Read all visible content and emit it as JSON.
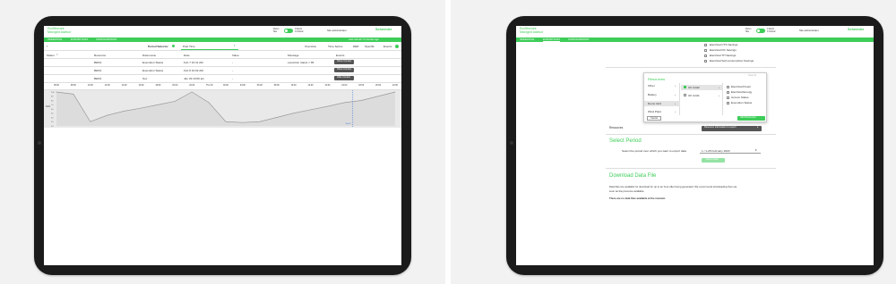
{
  "common": {
    "app_line1": "EcoStruxure",
    "app_line2": "Microgrid Advisor",
    "site_label_1": "Demo",
    "site_label_2": "Site",
    "alerts_1": "0 Alerts",
    "alerts_2": "0 Critical",
    "user": "Site administrator",
    "brand": "Schneider",
    "nav": [
      "OPERATION",
      "EXPORT DATA",
      "CONFIGURATION"
    ],
    "last_refresh": "Last refresh: 5 minutes ago"
  },
  "left": {
    "period_selector": "Period Selector",
    "period_value": "Past Time",
    "view_tabs": [
      "Overview",
      "Time Series",
      "DER",
      "Specific",
      "Events"
    ],
    "table_headers": [
      "Status",
      "Resource",
      "Data name",
      "Date",
      "Value",
      "Message",
      "Events"
    ],
    "rows": [
      {
        "resource": "BESS",
        "data_name": "Execution Status",
        "date": "Feb 7 10:11 AM",
        "value": "-",
        "message": "execution status = 86",
        "action": "Show Context"
      },
      {
        "resource": "BESS",
        "data_name": "Execution Status",
        "date": "Feb 8 10:02 AM",
        "value": "-",
        "message": "",
        "action": "Show Context"
      },
      {
        "resource": "BESS",
        "data_name": "Soc",
        "date": "Jan 29 10:06 am",
        "value": "-",
        "message": "",
        "action": "Hide Context"
      }
    ],
    "time_axis": [
      "06:00",
      "08:00",
      "10:00",
      "12:00",
      "14:00",
      "16:00",
      "18:00",
      "20:00",
      "22:00",
      "Thu 30",
      "02:00",
      "04:00",
      "06:00",
      "08:00",
      "10:00",
      "12:00",
      "14:00",
      "16:00",
      "18:00",
      "20:00",
      "22:00"
    ],
    "y_label": "SOC",
    "y_ticks": [
      "100",
      "90",
      "80",
      "70",
      "60",
      "50",
      "40",
      "30",
      "20"
    ],
    "marker_label": "Feb 8"
  },
  "right": {
    "checkbox_options": [
      "Electrical CTS Savings",
      "Electrical DC Savings",
      "Electrical TH Savings",
      "Electrical Self-consumption Savings"
    ],
    "resources_title": "Resources",
    "clear_all": "Clear all",
    "categories": [
      "Other",
      "Battery",
      "Demo Grid",
      "Wind Plant"
    ],
    "sub_items": [
      "UK Grid2",
      "UK Grid1"
    ],
    "data_items": [
      "Electrical Power",
      "Electrical Energy",
      "Access Status",
      "Execution Status"
    ],
    "cancel": "Cancel",
    "add_resources": "Add Resources",
    "resources_label": "Resources",
    "resource_info": "Resource information to export",
    "select_period": "Select Period",
    "period_prompt": "Select the period over which you want to export data",
    "period_value": "1 / 1-28 February 2020",
    "export_button": "Export Data",
    "download_title": "Download Data File",
    "download_desc_1": "Data files are available for download for up to an hour after being generated. We recommend downloading them as",
    "download_desc_2": "soon as they become available.",
    "no_files": "There are no data files available at the moment."
  },
  "chart_data": {
    "type": "line",
    "title": "",
    "xlabel": "",
    "ylabel": "SOC",
    "ylim": [
      20,
      100
    ],
    "x": [
      "06:00",
      "08:00",
      "10:00",
      "12:00",
      "14:00",
      "16:00",
      "18:00",
      "20:00",
      "22:00",
      "Thu 30",
      "02:00",
      "04:00",
      "06:00",
      "08:00",
      "10:00",
      "12:00",
      "14:00",
      "16:00",
      "18:00",
      "20:00",
      "22:00"
    ],
    "series": [
      {
        "values": [
          100,
          95,
          30,
          45,
          55,
          62,
          70,
          78,
          100,
          75,
          30,
          28,
          30,
          40,
          50,
          58,
          66,
          75,
          80,
          90,
          100
        ]
      }
    ],
    "grid": false,
    "colors": {
      "line": "#9a9a9a",
      "fill": "#e9e9e9",
      "marker": "#3d73d8"
    }
  },
  "colors": {
    "accent": "#3dcd58",
    "tablet": "#1b1b1b",
    "button_dark": "#555555"
  }
}
